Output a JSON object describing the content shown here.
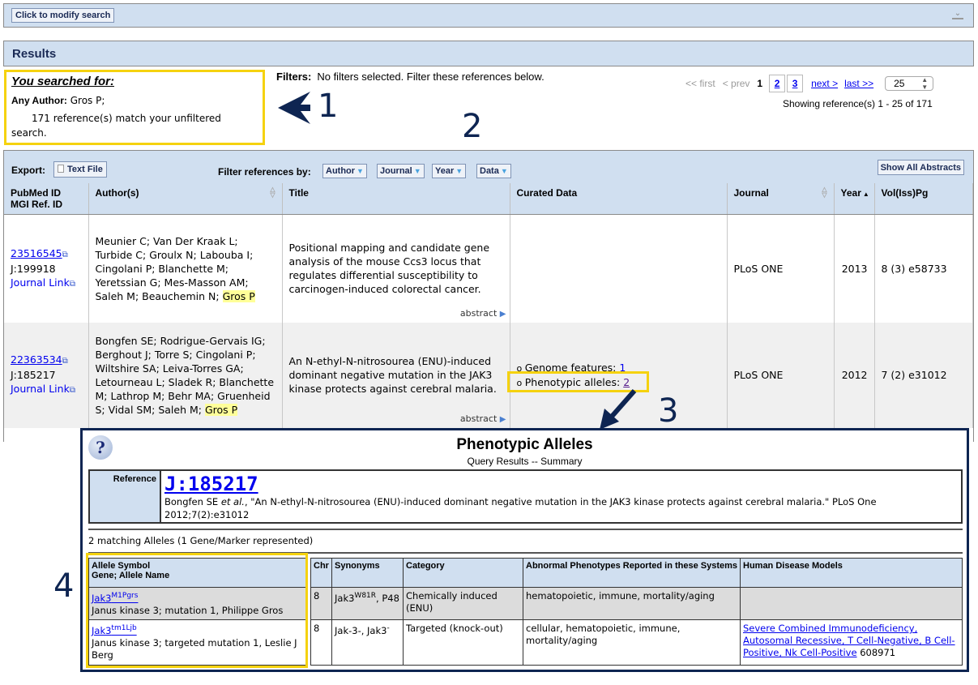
{
  "modify_bar": {
    "button_label": "Click to modify search",
    "collapse_icon": "collapse-chevron-icon"
  },
  "results": {
    "title": "Results"
  },
  "searched": {
    "title": "You searched for:",
    "criteria_label": "Any Author:",
    "criteria_value": "Gros P;",
    "count_text": "171 reference(s) match your unfiltered search."
  },
  "filters": {
    "label": "Filters:",
    "text": "No filters selected. Filter these references below."
  },
  "pager": {
    "first": "<< first",
    "prev": "< prev",
    "current": "1",
    "pages": [
      "2",
      "3"
    ],
    "next": "next >",
    "last": "last >>",
    "page_size": "25",
    "showing": "Showing reference(s) 1 - 25 of 171"
  },
  "annotations": {
    "n1": "1",
    "n2": "2",
    "n3": "3",
    "n4": "4"
  },
  "toolbar": {
    "export_label": "Export:",
    "text_file": "Text File",
    "filter_label": "Filter references by:",
    "filter_buttons": [
      "Author",
      "Journal",
      "Year",
      "Data"
    ],
    "show_abstracts": "Show All Abstracts"
  },
  "table": {
    "headers": {
      "pubmed_line1": "PubMed ID",
      "pubmed_line2": "MGI Ref. ID",
      "authors": "Author(s)",
      "title": "Title",
      "curated": "Curated Data",
      "journal": "Journal",
      "year": "Year",
      "volume": "Vol(Iss)Pg"
    },
    "rows": [
      {
        "pubmed_id": "23516545",
        "mgi_id": "J:199918",
        "journal_link": "Journal Link",
        "authors": "Meunier C; Van Der Kraak L; Turbide C; Groulx N; Labouba I; Cingolani P; Blanchette M; Yeretssian G; Mes-Masson AM; Saleh M; Beauchemin N;",
        "highlight_author": "Gros P",
        "title": "Positional mapping and candidate gene analysis of the mouse Ccs3 locus that regulates differential susceptibility to carcinogen-induced colorectal cancer.",
        "abstract_label": "abstract",
        "journal": "PLoS ONE",
        "year": "2013",
        "volume": "8 (3) e58733"
      },
      {
        "pubmed_id": "22363534",
        "mgi_id": "J:185217",
        "journal_link": "Journal Link",
        "authors": "Bongfen SE; Rodrigue-Gervais IG; Berghout J; Torre S; Cingolani P; Wiltshire SA; Leiva-Torres GA; Letourneau L; Sladek R; Blanchette M; Lathrop M; Behr MA; Gruenheid S; Vidal SM; Saleh M;",
        "highlight_author": "Gros P",
        "title": "An N-ethyl-N-nitrosourea (ENU)-induced dominant negative mutation in the JAK3 kinase protects against cerebral malaria.",
        "abstract_label": "abstract",
        "curated": [
          {
            "label": "Genome features:",
            "count": "1"
          },
          {
            "label": "Phenotypic alleles:",
            "count": "2"
          }
        ],
        "journal": "PLoS ONE",
        "year": "2012",
        "volume": "7 (2) e31012"
      }
    ]
  },
  "popup": {
    "title": "Phenotypic Alleles",
    "subtitle": "Query Results -- Summary",
    "reference_label": "Reference",
    "reference_id": "J:185217",
    "citation_author": "Bongfen SE",
    "citation_etal": "et al.",
    "citation_text": ", \"An N-ethyl-N-nitrosourea (ENU)-induced dominant negative mutation in the JAK3 kinase protects against cerebral malaria.\" PLoS One 2012;7(2):e31012",
    "match_text": "2 matching Alleles (1 Gene/Marker represented)",
    "headers": {
      "symbol_line1": "Allele Symbol",
      "symbol_line2": "Gene; Allele Name",
      "chr": "Chr",
      "synonyms": "Synonyms",
      "category": "Category",
      "phenotypes": "Abnormal Phenotypes Reported in these Systems",
      "disease": "Human Disease Models"
    },
    "alleles": [
      {
        "symbol_base": "Jak3",
        "symbol_sup": "M1Pgrs",
        "name": "Janus kinase 3; mutation 1, Philippe Gros",
        "chr": "8",
        "syn_base": "Jak3",
        "syn_sup": "W81R",
        "syn_rest": ", P48",
        "category": "Chemically induced (ENU)",
        "phenotypes": "hematopoietic, immune, mortality/aging",
        "disease_link": "",
        "disease_id": ""
      },
      {
        "symbol_base": "Jak3",
        "symbol_sup": "tm1Ljb",
        "name": "Janus kinase 3; targeted mutation 1, Leslie J Berg",
        "chr": "8",
        "syn_base": "Jak-3-, Jak3",
        "syn_sup": "-",
        "syn_rest": "",
        "category": "Targeted (knock-out)",
        "phenotypes": "cellular, hematopoietic, immune, mortality/aging",
        "disease_link": "Severe Combined Immunodeficiency, Autosomal Recessive, T Cell-Negative, B Cell-Positive, Nk Cell-Positive",
        "disease_id": "608971"
      }
    ]
  }
}
